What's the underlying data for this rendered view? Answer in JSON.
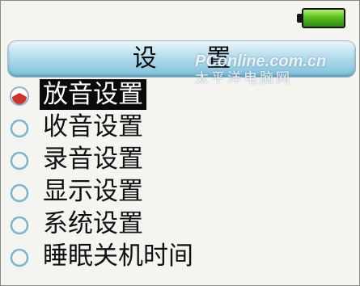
{
  "header": {
    "title": "设 置"
  },
  "status": {
    "battery_icon": "battery-full-icon",
    "battery_color": "#5bbf1e"
  },
  "watermark": {
    "line1": "PConline.com.cn",
    "line2": "太平洋电脑网"
  },
  "menu": {
    "items": [
      {
        "label": "放音设置",
        "selected": true
      },
      {
        "label": "收音设置",
        "selected": false
      },
      {
        "label": "录音设置",
        "selected": false
      },
      {
        "label": "显示设置",
        "selected": false
      },
      {
        "label": "系统设置",
        "selected": false
      },
      {
        "label": "睡眠关机时间",
        "selected": false
      }
    ],
    "selected_color": "#d0322c",
    "unselected_color": "#7fb3cc"
  }
}
